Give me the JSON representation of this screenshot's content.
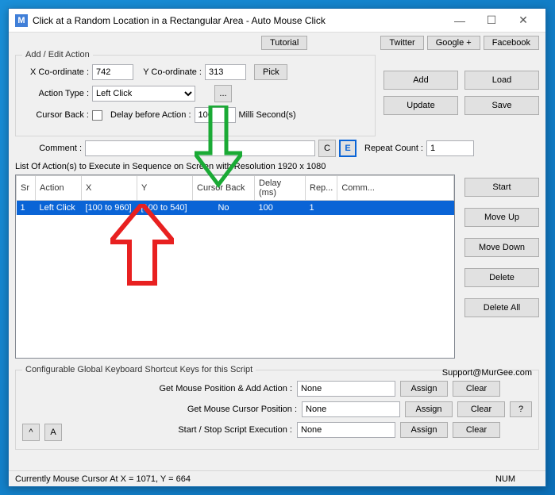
{
  "window": {
    "title": "Click at a Random Location in a Rectangular Area - Auto Mouse Click",
    "app_letter": "M"
  },
  "top_links": {
    "tutorial": "Tutorial",
    "twitter": "Twitter",
    "google": "Google +",
    "facebook": "Facebook"
  },
  "edit": {
    "legend": "Add / Edit Action",
    "xcoord_lbl": "X Co-ordinate :",
    "xcoord_val": "742",
    "ycoord_lbl": "Y Co-ordinate :",
    "ycoord_val": "313",
    "pick": "Pick",
    "action_type_lbl": "Action Type :",
    "action_type_val": "Left Click",
    "dots": "...",
    "cursor_back_lbl": "Cursor Back :",
    "delay_lbl": "Delay before Action :",
    "delay_val": "100",
    "delay_unit": "Milli Second(s)",
    "comment_lbl": "Comment :",
    "comment_val": "",
    "c": "C",
    "e": "E",
    "repeat_lbl": "Repeat Count :",
    "repeat_val": "1",
    "add": "Add",
    "load": "Load",
    "update": "Update",
    "save": "Save"
  },
  "list": {
    "caption": "List Of Action(s) to Execute in Sequence on Screen with Resolution 1920 x 1080",
    "headers": {
      "sr": "Sr",
      "action": "Action",
      "x": "X",
      "y": "Y",
      "cursor": "Cursor Back",
      "delay": "Delay (ms)",
      "rep": "Rep...",
      "comm": "Comm..."
    },
    "rows": [
      {
        "sr": "1",
        "action": "Left Click",
        "x": "[100 to 960]",
        "y": "[100 to 540]",
        "cursor": "No",
        "delay": "100",
        "rep": "1",
        "comm": ""
      }
    ],
    "side": {
      "start": "Start",
      "moveup": "Move Up",
      "movedown": "Move Down",
      "delete": "Delete",
      "deleteall": "Delete All"
    }
  },
  "shortcuts": {
    "legend": "Configurable Global Keyboard Shortcut Keys for this Script",
    "support": "Support@MurGee.com",
    "rows": [
      {
        "label": "Get Mouse Position & Add Action :",
        "value": "None"
      },
      {
        "label": "Get Mouse Cursor Position :",
        "value": "None"
      },
      {
        "label": "Start / Stop Script Execution :",
        "value": "None"
      }
    ],
    "assign": "Assign",
    "clear": "Clear",
    "help": "?",
    "caret": "^",
    "a": "A"
  },
  "status": {
    "text": "Currently Mouse Cursor At X = 1071, Y = 664",
    "num": "NUM"
  }
}
